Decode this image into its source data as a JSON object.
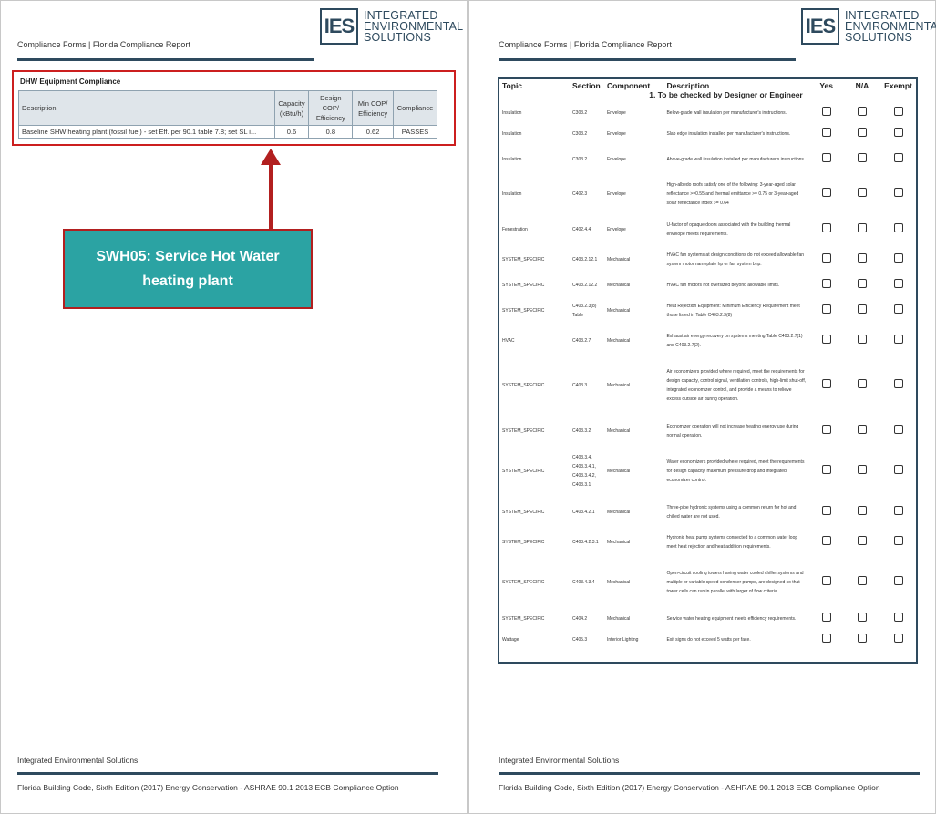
{
  "header": {
    "title": "Compliance Forms  | Florida Compliance Report",
    "logo_mark": "IES",
    "logo_line1": "INTEGRATED",
    "logo_line2": "ENVIRONMENTAL",
    "logo_line3": "SOLUTIONS"
  },
  "footer": {
    "company": "Integrated Environmental Solutions",
    "code": "Florida Building Code, Sixth Edition (2017) Energy Conservation - ASHRAE 90.1 2013 ECB Compliance Option"
  },
  "dhw": {
    "title": "DHW Equipment Compliance",
    "columns": {
      "description": "Description",
      "capacity": "Capacity (kBtu/h)",
      "design_cop": "Design COP/ Efficiency",
      "min_cop": "Min COP/ Efficiency",
      "compliance": "Compliance"
    },
    "row": {
      "description": "Baseline SHW heating plant (fossil fuel) - set Eff. per 90.1 table 7.8; set SL i...",
      "capacity": "0.6",
      "design_cop": "0.8",
      "min_cop": "0.62",
      "compliance": "PASSES"
    }
  },
  "callout": {
    "text": "SWH05: Service Hot Water heating plant",
    "color": "#2ba3a3",
    "border_color": "#b21f1f"
  },
  "checklist": {
    "headers": {
      "topic": "Topic",
      "section": "Section",
      "component": "Component",
      "description": "Description",
      "yes": "Yes",
      "na": "N/A",
      "exempt": "Exempt"
    },
    "group_title": "1. To be checked by Designer or Engineer",
    "rows": [
      {
        "topic": "Insulation",
        "section": "C303.2",
        "component": "Envelope",
        "description": "Below-grade wall insulation per manufacturer's instructions."
      },
      {
        "topic": "Insulation",
        "section": "C303.2",
        "component": "Envelope",
        "description": "Slab edge insulation installed per manufacturer's instructions."
      },
      {
        "topic": "Insulation",
        "section": "C303.2",
        "component": "Envelope",
        "description": "Above-grade wall insulation installed per manufacturer's instructions."
      },
      {
        "topic": "Insulation",
        "section": "C402.3",
        "component": "Envelope",
        "description": "High-albedo roofs satisfy one of the following: 3-year-aged solar reflectance >=0.55 and thermal emittance >= 0.75 or 3-year-aged solar reflectance index >= 0.64"
      },
      {
        "topic": "Fenestration",
        "section": "C402.4.4",
        "component": "Envelope",
        "description": "U-factor of opaque doors associated with the building thermal envelope meets requirements."
      },
      {
        "topic": "SYSTEM_SPECIFIC",
        "section": "C403.2.12.1",
        "component": "Mechanical",
        "description": "HVAC fan systems at design conditions do not exceed allowable fan system motor nameplate hp or fan system bhp."
      },
      {
        "topic": "SYSTEM_SPECIFIC",
        "section": "C403.2.12.2",
        "component": "Mechanical",
        "description": "HVAC fan motors not oversized beyond allowable limits."
      },
      {
        "topic": "SYSTEM_SPECIFIC",
        "section": "C403.2.3(8) Table",
        "component": "Mechanical",
        "description": "Heat Rejection Equipment: Minimum Efficiency Requirement meet those listed in Table C403.2.3(8)"
      },
      {
        "topic": "HVAC",
        "section": "C403.2.7",
        "component": "Mechanical",
        "description": "Exhaust air energy recovery on systems meeting Table C403.2.7(1) and C403.2.7(2)."
      },
      {
        "topic": "SYSTEM_SPECIFIC",
        "section": "C403.3",
        "component": "Mechanical",
        "description": "Air economizers provided where required, meet the requirements for design capacity, control signal, ventilation controls, high-limit shut-off, integrated economizer control, and provide a means to relieve excess outside air during operation."
      },
      {
        "topic": "SYSTEM_SPECIFIC",
        "section": "C403.3.2",
        "component": "Mechanical",
        "description": "Economizer operation will not increase heating energy use during normal operation."
      },
      {
        "topic": "SYSTEM_SPECIFIC",
        "section": "C403.3.4, C403.3.4.1, C403.3.4.2, C403.3.1",
        "component": "Mechanical",
        "description": "Water economizers provided where required, meet the requirements for design capacity, maximum pressure drop and integrated economizer control."
      },
      {
        "topic": "SYSTEM_SPECIFIC",
        "section": "C403.4.2.1",
        "component": "Mechanical",
        "description": "Three-pipe hydronic systems using a common return for hot and chilled water are not used."
      },
      {
        "topic": "SYSTEM_SPECIFIC",
        "section": "C403.4.2.3.1",
        "component": "Mechanical",
        "description": "Hydronic heat pump systems connected to a common water loop meet heat rejection and heat addition requirements."
      },
      {
        "topic": "SYSTEM_SPECIFIC",
        "section": "C403.4.3.4",
        "component": "Mechanical",
        "description": "Open-circuit cooling towers having water cooled chiller systems and multiple or variable speed condenser pumps, are designed so that tower cells can run in parallel with larger of flow criteria."
      },
      {
        "topic": "SYSTEM_SPECIFIC",
        "section": "C404.2",
        "component": "Mechanical",
        "description": "Service water heating equipment meets efficiency requirements."
      },
      {
        "topic": "Wattage",
        "section": "C405.3",
        "component": "Interior Lighting",
        "description": "Exit signs do not exceed 5 watts per face."
      }
    ]
  }
}
